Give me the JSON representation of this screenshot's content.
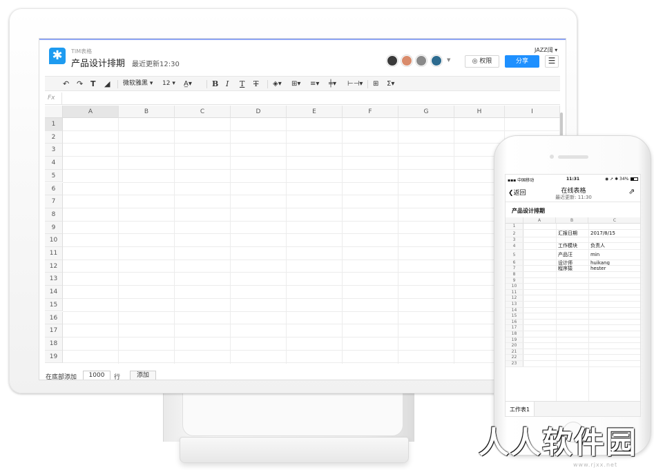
{
  "app": {
    "name": "TIM表格",
    "doc_title": "产品设计排期",
    "last_updated": "最近更新12:30",
    "user_name": "JAZZ阔",
    "permission_label": "权限",
    "share_label": "分享",
    "avatars": [
      "#3a3a3a",
      "#d98b6b",
      "#8a8a8a",
      "#2d6b8f"
    ]
  },
  "toolbar": {
    "font_name": "微软雅黑",
    "font_size": "12",
    "bold": "B",
    "italic": "I",
    "sum": "Σ"
  },
  "formula_bar": {
    "label": "Fx"
  },
  "sheet": {
    "columns": [
      "A",
      "B",
      "C",
      "D",
      "E",
      "F",
      "G",
      "H",
      "I"
    ],
    "rows": [
      "1",
      "2",
      "3",
      "4",
      "5",
      "6",
      "7",
      "8",
      "9",
      "10",
      "11",
      "12",
      "13",
      "14",
      "15",
      "16",
      "17",
      "18",
      "19"
    ],
    "active_column": "A",
    "active_row": "1"
  },
  "bottom_bar": {
    "prefix": "在底部添加",
    "count": "1000",
    "unit": "行",
    "add_label": "添加"
  },
  "mobile": {
    "carrier": "中国移动",
    "time": "11:31",
    "battery": "34%",
    "back_label": "返回",
    "title": "在线表格",
    "subtitle": "最近更新: 11:30",
    "doc_title": "产品设计排期",
    "columns": [
      "A",
      "B",
      "C"
    ],
    "rows": [
      "1",
      "2",
      "3",
      "4",
      "5",
      "6",
      "7",
      "8",
      "9",
      "10",
      "11",
      "12",
      "13",
      "14",
      "15",
      "16",
      "17",
      "18",
      "19",
      "20",
      "21",
      "22",
      "23"
    ],
    "cells": [
      {
        "row": "2",
        "b": "汇报日期",
        "c": "2017/8/15"
      },
      {
        "row": "4",
        "b": "工作模块",
        "c": "负责人"
      },
      {
        "row": "5",
        "b": "产品汪",
        "c": "min"
      },
      {
        "row": "6",
        "b": "设计师",
        "c": "huikang"
      },
      {
        "row": "7",
        "b": "程序猿",
        "c": "hester"
      }
    ],
    "sheet_tab": "工作表1"
  },
  "watermark": {
    "text": "人人软件园",
    "sub": "www.rjxx.net"
  }
}
